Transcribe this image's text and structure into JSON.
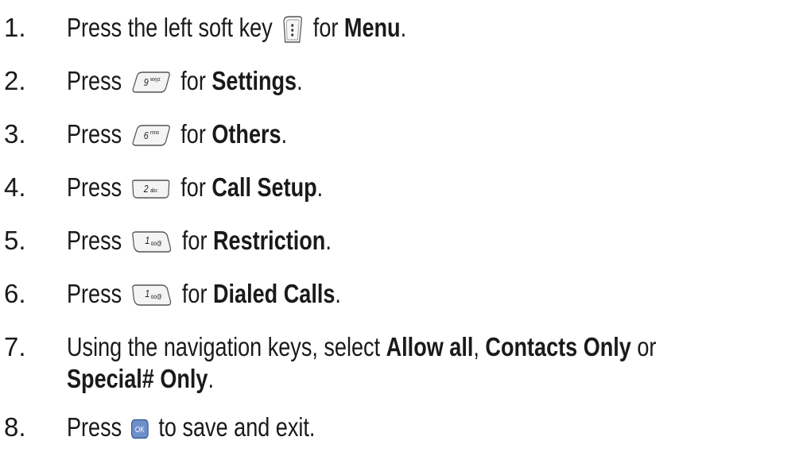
{
  "steps": [
    {
      "num": "1.",
      "pre": "Press the left soft key",
      "key": "softkey-left",
      "mid": "for",
      "bold": "Menu",
      "post": "."
    },
    {
      "num": "2.",
      "pre": "Press",
      "key": "9wxyz",
      "key_label": "9",
      "key_sub": "wxyz",
      "mid": "for",
      "bold": "Settings",
      "post": "."
    },
    {
      "num": "3.",
      "pre": "Press",
      "key": "6mno",
      "key_label": "6",
      "key_sub": "mno",
      "mid": "for",
      "bold": "Others",
      "post": "."
    },
    {
      "num": "4.",
      "pre": "Press",
      "key": "2abc",
      "key_label": "2",
      "key_sub": "abc",
      "mid": "for",
      "bold": "Call Setup",
      "post": "."
    },
    {
      "num": "5.",
      "pre": "Press",
      "key": "1voicemail",
      "key_label": "1",
      "key_sub": "oo@",
      "mid": "for",
      "bold": "Restriction",
      "post": "."
    },
    {
      "num": "6.",
      "pre": "Press",
      "key": "1voicemail",
      "key_label": "1",
      "key_sub": "oo@",
      "mid": "for",
      "bold": "Dialed Calls",
      "post": "."
    },
    {
      "num": "7.",
      "line1_pre": "Using the navigation keys, select",
      "bold1": "Allow all",
      "sep1": ",",
      "bold2": "Contacts Only",
      "sep2": "or",
      "bold3": "Special# Only",
      "post": "."
    },
    {
      "num": "8.",
      "pre": "Press",
      "key": "ok",
      "key_label": "OK",
      "mid": "to save and exit."
    }
  ]
}
